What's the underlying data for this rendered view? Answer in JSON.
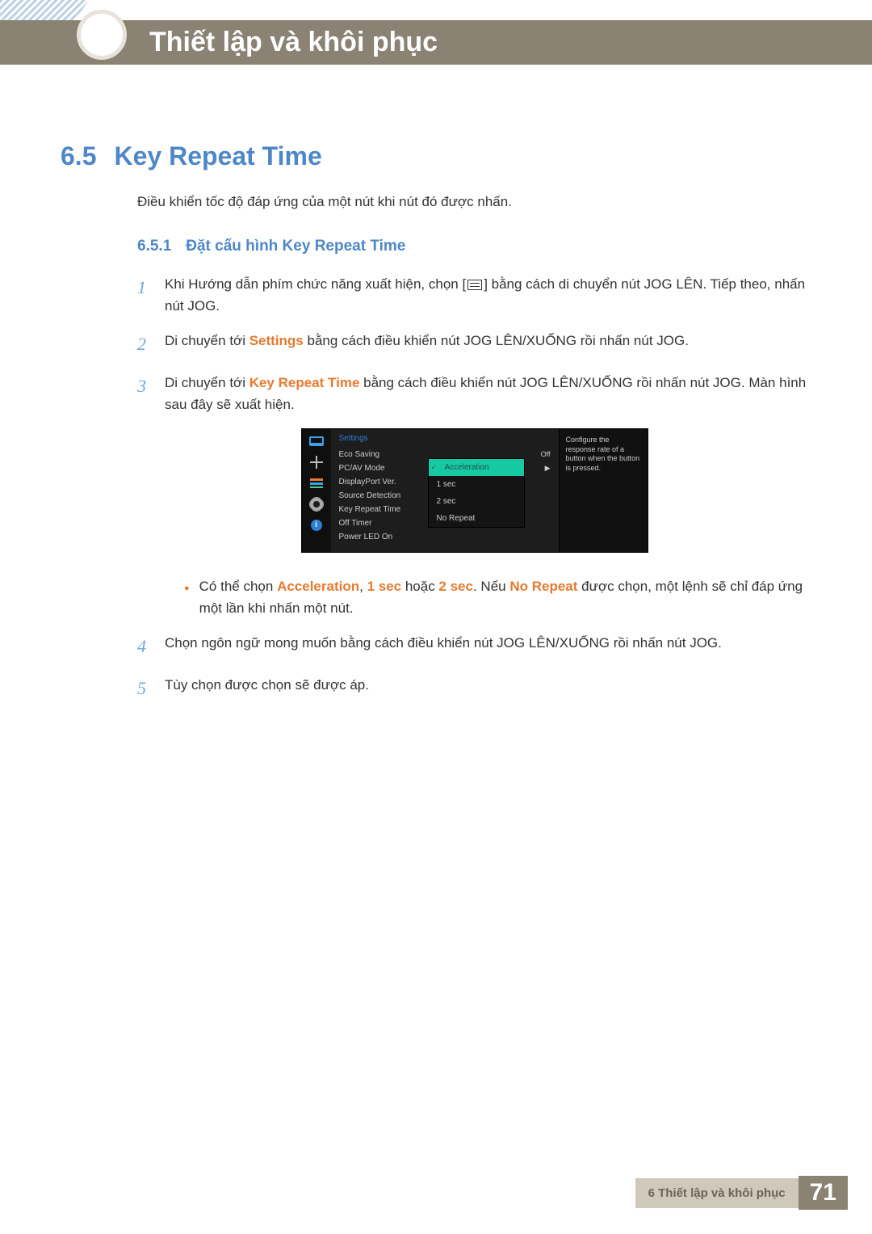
{
  "header": {
    "title": "Thiết lập và khôi phục"
  },
  "section": {
    "num": "6.5",
    "title": "Key Repeat Time"
  },
  "intro": "Điều khiển tốc độ đáp ứng của một nút khi nút đó được nhấn.",
  "subsection": {
    "num": "6.5.1",
    "title": "Đặt cấu hình Key Repeat Time"
  },
  "steps": {
    "s1": {
      "num": "1",
      "pre": "Khi Hướng dẫn phím chức năng xuất hiện, chọn [",
      "post": "] bằng cách di chuyển nút JOG LÊN. Tiếp theo, nhấn nút JOG."
    },
    "s2": {
      "num": "2",
      "pre": "Di chuyển tới ",
      "hl": "Settings",
      "post": " bằng cách điều khiển nút JOG LÊN/XUỐNG rồi nhấn nút JOG."
    },
    "s3": {
      "num": "3",
      "pre": "Di chuyển tới ",
      "hl": "Key Repeat Time",
      "post": " bằng cách điều khiển nút JOG LÊN/XUỐNG rồi nhấn nút JOG. Màn hình sau đây sẽ xuất hiện."
    },
    "bullet": {
      "t1": "Có thể chọn ",
      "a": "Acceleration",
      "comma": ", ",
      "b": "1 sec",
      "or": " hoặc ",
      "c": "2 sec",
      "t2": ". Nếu ",
      "d": "No Repeat",
      "t3": " được chọn, một lệnh sẽ chỉ đáp ứng một lần khi nhấn một nút."
    },
    "s4": {
      "num": "4",
      "text": "Chọn ngôn ngữ mong muốn bằng cách điều khiển nút JOG LÊN/XUỐNG rồi nhấn nút JOG."
    },
    "s5": {
      "num": "5",
      "text": "Tùy chọn được chọn sẽ được áp."
    }
  },
  "osd": {
    "heading": "Settings",
    "items": {
      "eco": {
        "label": "Eco Saving",
        "val": "Off"
      },
      "pcav": {
        "label": "PC/AV Mode",
        "val": "▶"
      },
      "dp": {
        "label": "DisplayPort Ver."
      },
      "src": {
        "label": "Source Detection"
      },
      "krt": {
        "label": "Key Repeat Time"
      },
      "off": {
        "label": "Off Timer"
      },
      "led": {
        "label": "Power LED On"
      }
    },
    "popup": {
      "accel": "Acceleration",
      "one": "1 sec",
      "two": "2 sec",
      "nr": "No Repeat"
    },
    "help": "Configure the response rate of a button when the button is pressed.",
    "info_glyph": "i"
  },
  "footer": {
    "label": "6 Thiết lập và khôi phục",
    "page": "71"
  }
}
